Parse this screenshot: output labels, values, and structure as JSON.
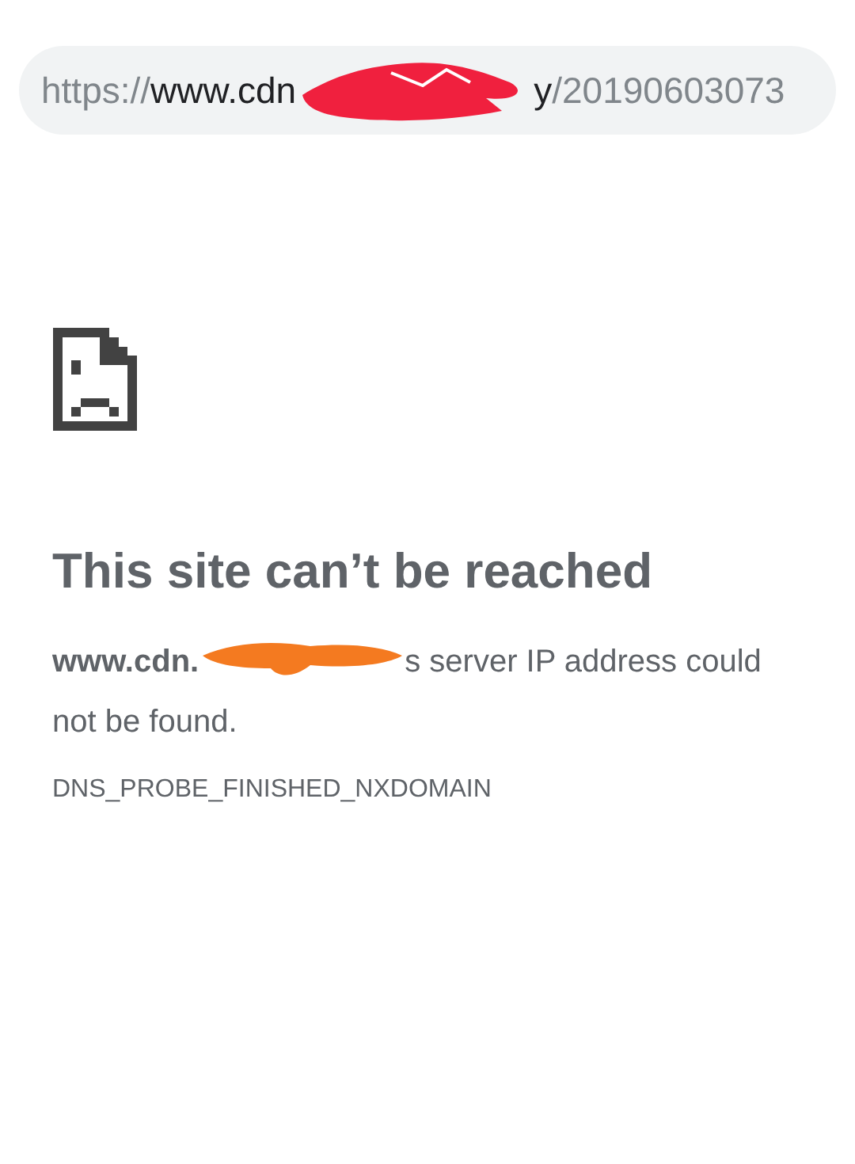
{
  "address_bar": {
    "scheme": "https://",
    "host_start": "www.cdn",
    "host_end": "y",
    "path": "/20190603073"
  },
  "error": {
    "title": "This site can’t be reached",
    "message_host": "www.cdn.",
    "message_rest": "s server IP address could",
    "message_line_2": "not be found.",
    "code": "DNS_PROBE_FINISHED_NXDOMAIN"
  }
}
